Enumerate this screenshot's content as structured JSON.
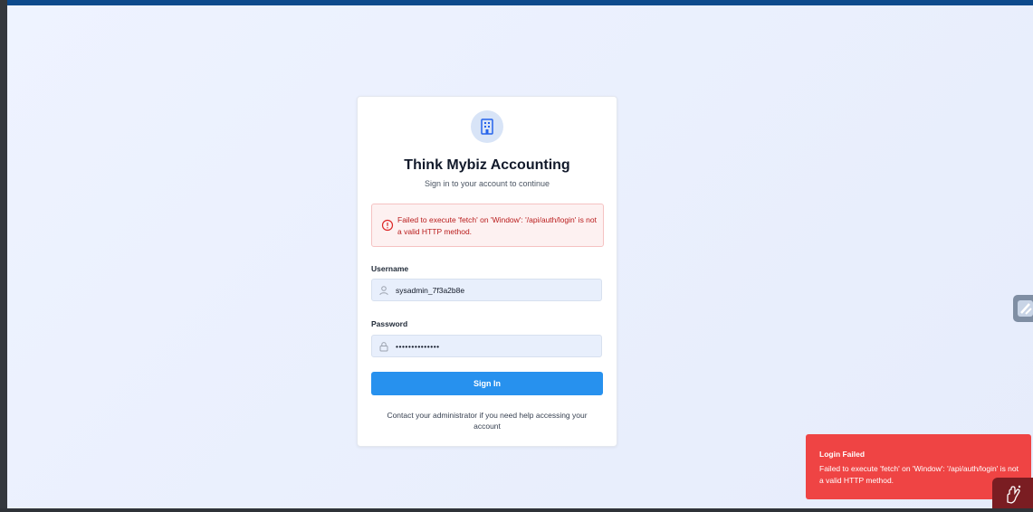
{
  "app": {
    "title": "Think Mybiz Accounting",
    "subtitle": "Sign in to your account to continue",
    "logo_icon": "building-icon"
  },
  "error": {
    "icon": "alert-circle-icon",
    "message": "Failed to execute 'fetch' on 'Window': '/api/auth/login' is not a valid HTTP method."
  },
  "form": {
    "username_label": "Username",
    "username_value": "sysadmin_7f3a2b8e",
    "username_icon": "user-icon",
    "password_label": "Password",
    "password_value": "••••••••••••••",
    "password_icon": "lock-icon",
    "submit_label": "Sign In"
  },
  "help": {
    "text": "Contact your administrator if you need help accessing your account"
  },
  "toast": {
    "title": "Login Failed",
    "message": "Failed to execute 'fetch' on 'Window': '/api/auth/login' is not a valid HTTP method."
  },
  "colors": {
    "accent": "#2791ee",
    "error": "#ef4444",
    "header": "#0d4a8c"
  }
}
